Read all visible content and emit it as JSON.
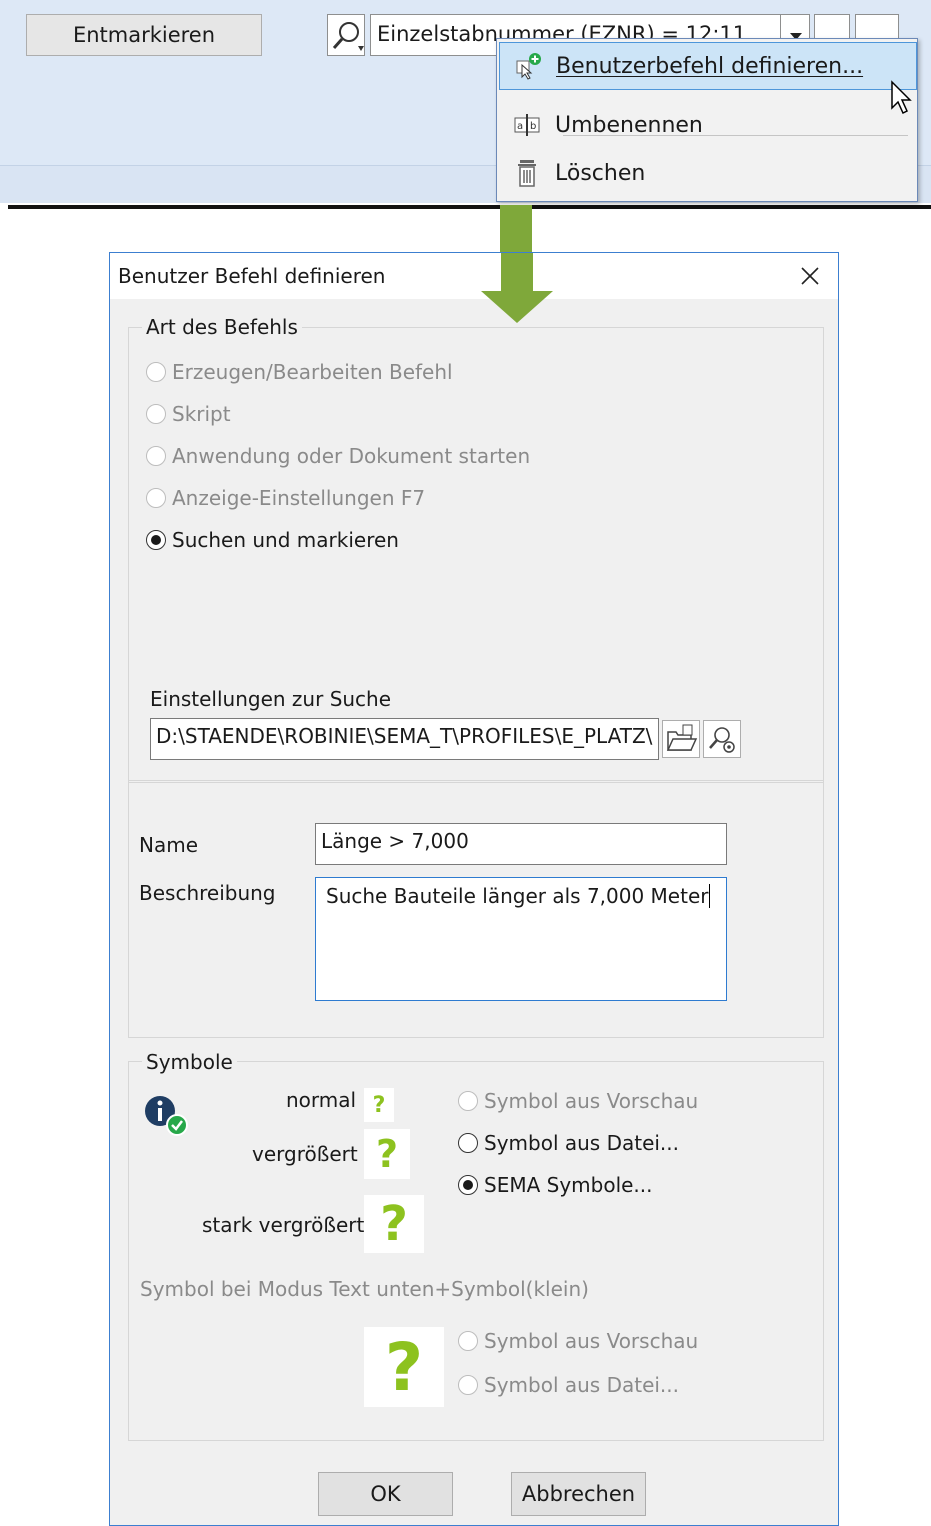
{
  "toolbar": {
    "unmark_button": "Entmarkieren",
    "search_value": "Einzelstabnummer (EZNR) = 12:11"
  },
  "context_menu": {
    "items": [
      {
        "label": "Benutzerbefehl definieren...",
        "icon": "add-command-icon"
      },
      {
        "label": "Umbenennen",
        "icon": "rename-icon"
      },
      {
        "label": "Löschen",
        "icon": "trash-icon"
      }
    ]
  },
  "dialog": {
    "title": "Benutzer Befehl definieren",
    "command_type": {
      "caption": "Art des Befehls",
      "options": [
        {
          "label": "Erzeugen/Bearbeiten Befehl",
          "enabled": false,
          "selected": false
        },
        {
          "label": "Skript",
          "enabled": false,
          "selected": false
        },
        {
          "label": "Anwendung oder Dokument starten",
          "enabled": false,
          "selected": false
        },
        {
          "label": "Anzeige-Einstellungen F7",
          "enabled": false,
          "selected": false
        },
        {
          "label": "Suchen und markieren",
          "enabled": true,
          "selected": true
        }
      ],
      "search_settings_label": "Einstellungen zur Suche",
      "search_settings_path": "D:\\STAENDE\\ROBINIE\\SEMA_T\\PROFILES\\E_PLATZ\\"
    },
    "name_label": "Name",
    "name_value": "Länge > 7,000",
    "description_label": "Beschreibung",
    "description_value": "Suche Bauteile länger als 7,000 Meter",
    "symbols": {
      "caption": "Symbole",
      "normal_label": "normal",
      "enlarged_label": "vergrößert",
      "strongly_enlarged_label": "stark vergrößert",
      "options": [
        {
          "label": "Symbol aus Vorschau",
          "enabled": false,
          "selected": false
        },
        {
          "label": "Symbol aus Datei...",
          "enabled": true,
          "selected": false
        },
        {
          "label": "SEMA Symbole...",
          "enabled": true,
          "selected": true
        }
      ],
      "text_mode_label": "Symbol bei Modus Text unten+Symbol(klein)",
      "text_mode_options": [
        {
          "label": "Symbol aus Vorschau",
          "enabled": false,
          "selected": false
        },
        {
          "label": "Symbol aus Datei...",
          "enabled": false,
          "selected": false
        }
      ],
      "placeholder_glyph": "?",
      "glyph_color": "#8dc21f"
    },
    "ok_button": "OK",
    "cancel_button": "Abbrechen"
  },
  "colors": {
    "arrow": "#7fa83a",
    "accent": "#4d96da"
  }
}
